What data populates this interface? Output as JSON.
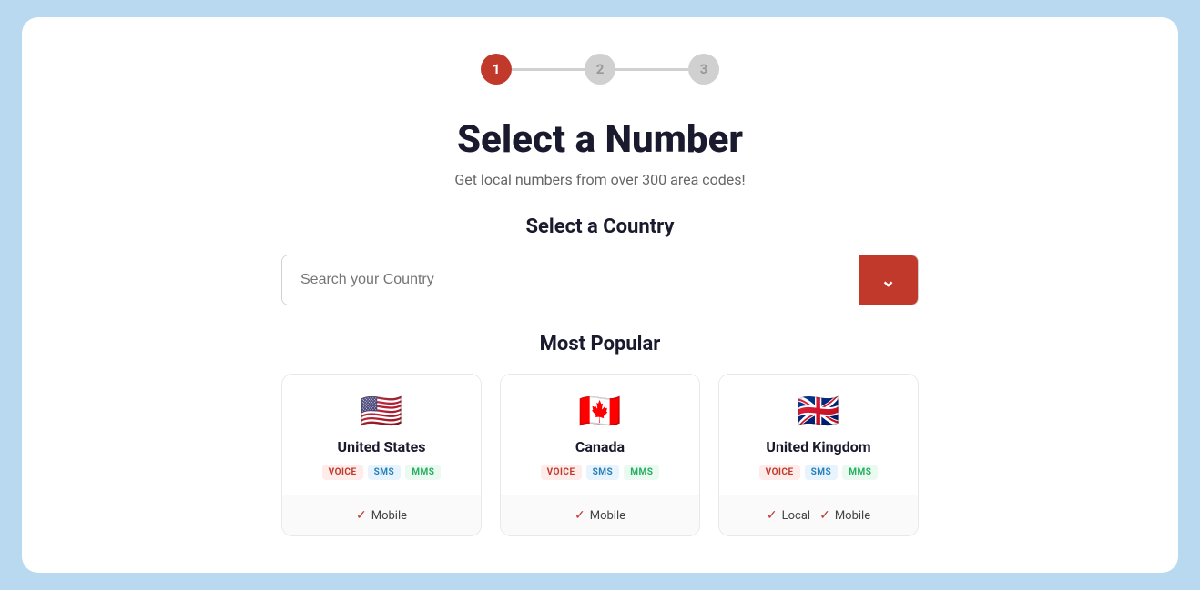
{
  "stepper": {
    "steps": [
      {
        "label": "1",
        "active": true
      },
      {
        "label": "2",
        "active": false
      },
      {
        "label": "3",
        "active": false
      }
    ]
  },
  "header": {
    "title": "Select a Number",
    "subtitle": "Get local numbers from over 300 area codes!"
  },
  "country_search": {
    "label": "Select a Country",
    "placeholder": "Search your Country",
    "button_icon": "chevron-down"
  },
  "popular": {
    "label": "Most Popular",
    "countries": [
      {
        "name": "United States",
        "flag": "🇺🇸",
        "badges": [
          "VOICE",
          "SMS",
          "MMS"
        ],
        "number_types": [
          "Mobile"
        ]
      },
      {
        "name": "Canada",
        "flag": "🇨🇦",
        "badges": [
          "VOICE",
          "SMS",
          "MMS"
        ],
        "number_types": [
          "Mobile"
        ]
      },
      {
        "name": "United Kingdom",
        "flag": "🇬🇧",
        "badges": [
          "VOICE",
          "SMS",
          "MMS"
        ],
        "number_types": [
          "Local",
          "Mobile"
        ]
      }
    ]
  },
  "colors": {
    "accent": "#c0392b",
    "background": "#b8d9f0"
  }
}
